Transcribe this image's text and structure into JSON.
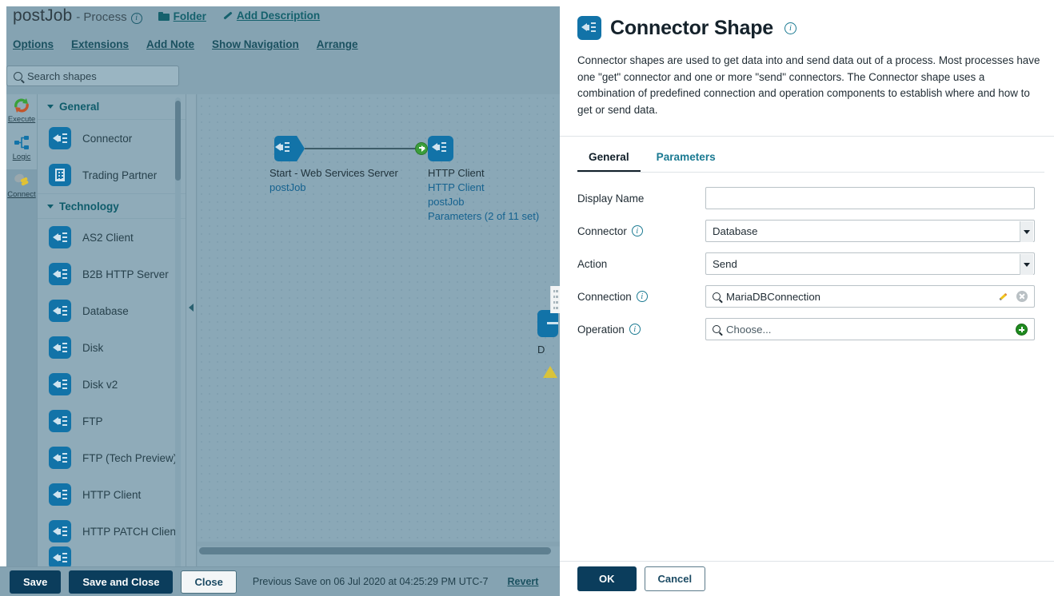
{
  "designer": {
    "process_name": "postJob",
    "process_type": "- Process",
    "info_icon": "info-icon",
    "folder_link": "Folder",
    "add_description_link": "Add Description",
    "menu": [
      "Options",
      "Extensions",
      "Add Note",
      "Show Navigation",
      "Arrange"
    ],
    "rail": [
      {
        "label": "Execute",
        "icon": "execute-icon"
      },
      {
        "label": "Logic",
        "icon": "logic-icon"
      },
      {
        "label": "Connect",
        "icon": "connect-icon"
      }
    ],
    "search": {
      "placeholder": "Search shapes",
      "value": "",
      "icon": "search-icon"
    },
    "palette": [
      {
        "group": "General",
        "items": [
          {
            "label": "Connector",
            "icon": "connector-icon"
          },
          {
            "label": "Trading Partner",
            "icon": "trading-partner-icon"
          }
        ]
      },
      {
        "group": "Technology",
        "items": [
          {
            "label": "AS2 Client",
            "icon": "connector-icon"
          },
          {
            "label": "B2B HTTP Server",
            "icon": "connector-icon"
          },
          {
            "label": "Database",
            "icon": "connector-icon"
          },
          {
            "label": "Disk",
            "icon": "connector-icon"
          },
          {
            "label": "Disk v2",
            "icon": "connector-icon"
          },
          {
            "label": "FTP",
            "icon": "connector-icon"
          },
          {
            "label": "FTP (Tech Preview)",
            "icon": "connector-icon"
          },
          {
            "label": "HTTP Client",
            "icon": "connector-icon"
          },
          {
            "label": "HTTP PATCH Client",
            "icon": "connector-icon"
          }
        ]
      }
    ],
    "canvas": {
      "start_shape": {
        "title": "Start - Web Services Server",
        "subtitle": "postJob"
      },
      "http_shape": {
        "title": "HTTP Client",
        "line1": "HTTP Client",
        "line2": "postJob",
        "line3": "Parameters (2 of 11 set)"
      },
      "occluded_shape_label": "D"
    },
    "bottom_bar": {
      "save": "Save",
      "save_and_close": "Save and Close",
      "close": "Close",
      "previous_save": "Previous Save on 06 Jul 2020 at 04:25:29 PM UTC-7",
      "revert": "Revert"
    }
  },
  "dialog": {
    "title": "Connector Shape",
    "title_icon": "connector-icon",
    "title_info_icon": "info-icon",
    "description": "Connector shapes are used to get data into and send data out of a process. Most processes have one \"get\" connector and one or more \"send\" connectors. The Connector shape uses a combination of predefined connection and operation components to establish where and how to get or send data.",
    "tabs": [
      {
        "label": "General",
        "active": true
      },
      {
        "label": "Parameters",
        "active": false
      }
    ],
    "fields": {
      "display_name": {
        "label": "Display Name",
        "value": "",
        "placeholder": ""
      },
      "connector": {
        "label": "Connector",
        "value": "Database",
        "info_icon": "info-icon"
      },
      "action": {
        "label": "Action",
        "value": "Send",
        "info_icon": "info-icon"
      },
      "connection": {
        "label": "Connection",
        "value": "MariaDBConnection",
        "info_icon": "info-icon",
        "edit_icon": "pencil-icon",
        "clear_icon": "clear-icon"
      },
      "operation": {
        "label": "Operation",
        "placeholder": "Choose...",
        "value": "",
        "info_icon": "info-icon",
        "add_icon": "add-icon"
      }
    },
    "footer": {
      "ok": "OK",
      "cancel": "Cancel"
    }
  },
  "colors": {
    "accent_blue": "#1273a8",
    "teal_link": "#15616d",
    "dark_navy_button": "#0b3d5c",
    "panel_overlay": "#8aa8b7",
    "green_arrow": "#3b9e3b"
  }
}
